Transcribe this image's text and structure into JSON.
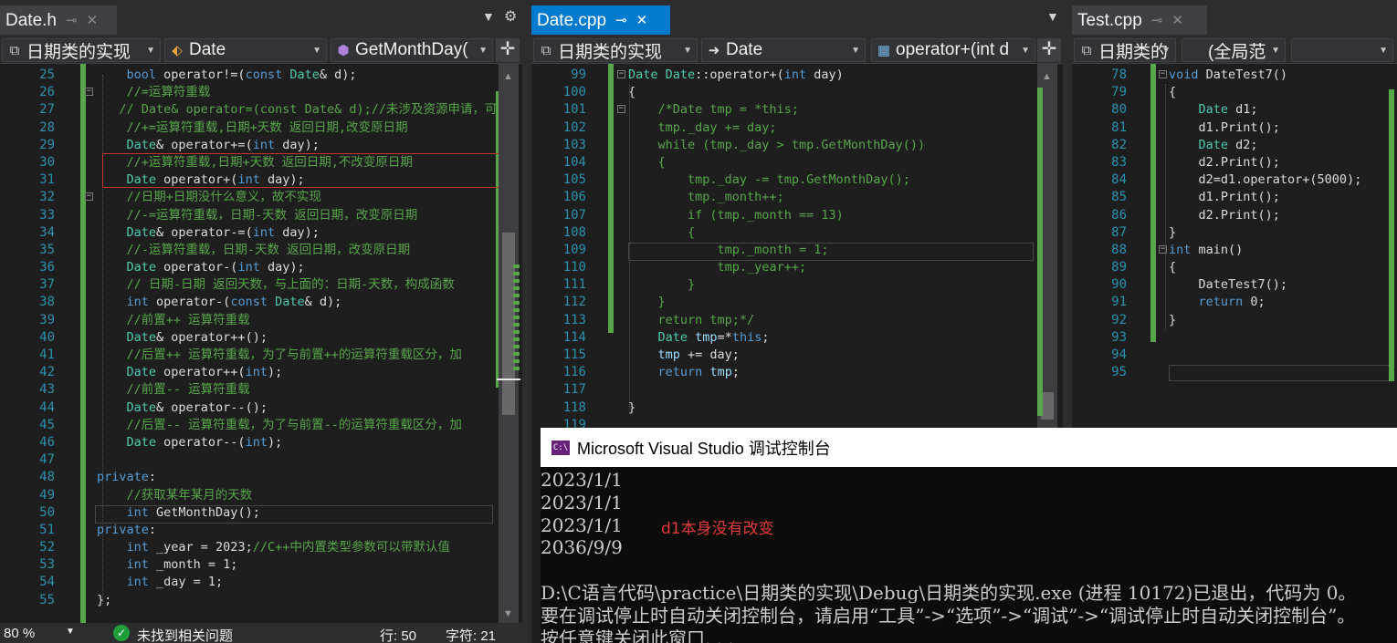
{
  "panes": {
    "date_h": {
      "tab": {
        "filename": "Date.h"
      },
      "nav": {
        "project": "日期类的实现",
        "class": "Date",
        "member": "GetMonthDay("
      },
      "lines": [
        {
          "n": "25",
          "seg": [
            {
              "t": "    "
            },
            {
              "t": "bool",
              "c": "#569cd6"
            },
            {
              "t": " operator!=("
            },
            {
              "t": "const",
              "c": "#569cd6"
            },
            {
              "t": " "
            },
            {
              "t": "Date",
              "c": "#4ec9b0"
            },
            {
              "t": "& d);"
            }
          ]
        },
        {
          "n": "26",
          "seg": [
            {
              "t": "    "
            },
            {
              "t": "//=运算符重载",
              "c": "#57a64a"
            }
          ]
        },
        {
          "n": "27",
          "seg": [
            {
              "t": "   "
            },
            {
              "t": "// Date& operator=(const Date& d);//未涉及资源申请，可",
              "c": "#57a64a"
            }
          ]
        },
        {
          "n": "28",
          "seg": [
            {
              "t": "    "
            },
            {
              "t": "//+=运算符重载,日期+天数 返回日期,改变原日期",
              "c": "#57a64a"
            }
          ]
        },
        {
          "n": "29",
          "seg": [
            {
              "t": "    "
            },
            {
              "t": "Date",
              "c": "#4ec9b0"
            },
            {
              "t": "& operator+=("
            },
            {
              "t": "int",
              "c": "#569cd6"
            },
            {
              "t": " day);"
            }
          ]
        },
        {
          "n": "30",
          "seg": [
            {
              "t": "    "
            },
            {
              "t": "//+运算符重载,日期+天数 返回日期,不改变原日期",
              "c": "#57a64a"
            }
          ]
        },
        {
          "n": "31",
          "seg": [
            {
              "t": "    "
            },
            {
              "t": "Date",
              "c": "#4ec9b0"
            },
            {
              "t": " operator+("
            },
            {
              "t": "int",
              "c": "#569cd6"
            },
            {
              "t": " day);"
            }
          ]
        },
        {
          "n": "32",
          "seg": [
            {
              "t": "    "
            },
            {
              "t": "//日期+日期没什么意义，故不实现",
              "c": "#57a64a"
            }
          ]
        },
        {
          "n": "33",
          "seg": [
            {
              "t": "    "
            },
            {
              "t": "//-=运算符重载，日期-天数 返回日期，改变原日期",
              "c": "#57a64a"
            }
          ]
        },
        {
          "n": "34",
          "seg": [
            {
              "t": "    "
            },
            {
              "t": "Date",
              "c": "#4ec9b0"
            },
            {
              "t": "& operator-=("
            },
            {
              "t": "int",
              "c": "#569cd6"
            },
            {
              "t": " day);"
            }
          ]
        },
        {
          "n": "35",
          "seg": [
            {
              "t": "    "
            },
            {
              "t": "//-运算符重载，日期-天数 返回日期，改变原日期",
              "c": "#57a64a"
            }
          ]
        },
        {
          "n": "36",
          "seg": [
            {
              "t": "    "
            },
            {
              "t": "Date",
              "c": "#4ec9b0"
            },
            {
              "t": " operator-("
            },
            {
              "t": "int",
              "c": "#569cd6"
            },
            {
              "t": " day);"
            }
          ]
        },
        {
          "n": "37",
          "seg": [
            {
              "t": "    "
            },
            {
              "t": "// 日期-日期 返回天数，与上面的：日期-天数，构成函数",
              "c": "#57a64a"
            }
          ]
        },
        {
          "n": "38",
          "seg": [
            {
              "t": "    "
            },
            {
              "t": "int",
              "c": "#569cd6"
            },
            {
              "t": " operator-("
            },
            {
              "t": "const",
              "c": "#569cd6"
            },
            {
              "t": " "
            },
            {
              "t": "Date",
              "c": "#4ec9b0"
            },
            {
              "t": "& d);"
            }
          ]
        },
        {
          "n": "39",
          "seg": [
            {
              "t": "    "
            },
            {
              "t": "//前置++ 运算符重载",
              "c": "#57a64a"
            }
          ]
        },
        {
          "n": "40",
          "seg": [
            {
              "t": "    "
            },
            {
              "t": "Date",
              "c": "#4ec9b0"
            },
            {
              "t": "& operator++();"
            }
          ]
        },
        {
          "n": "41",
          "seg": [
            {
              "t": "    "
            },
            {
              "t": "//后置++ 运算符重载，为了与前置++的运算符重载区分，加",
              "c": "#57a64a"
            }
          ]
        },
        {
          "n": "42",
          "seg": [
            {
              "t": "    "
            },
            {
              "t": "Date",
              "c": "#4ec9b0"
            },
            {
              "t": " operator++("
            },
            {
              "t": "int",
              "c": "#569cd6"
            },
            {
              "t": ");"
            }
          ]
        },
        {
          "n": "43",
          "seg": [
            {
              "t": "    "
            },
            {
              "t": "//前置-- 运算符重载",
              "c": "#57a64a"
            }
          ]
        },
        {
          "n": "44",
          "seg": [
            {
              "t": "    "
            },
            {
              "t": "Date",
              "c": "#4ec9b0"
            },
            {
              "t": "& operator--();"
            }
          ]
        },
        {
          "n": "45",
          "seg": [
            {
              "t": "    "
            },
            {
              "t": "//后置-- 运算符重载，为了与前置--的运算符重载区分，加",
              "c": "#57a64a"
            }
          ]
        },
        {
          "n": "46",
          "seg": [
            {
              "t": "    "
            },
            {
              "t": "Date",
              "c": "#4ec9b0"
            },
            {
              "t": " operator--("
            },
            {
              "t": "int",
              "c": "#569cd6"
            },
            {
              "t": ");"
            }
          ]
        },
        {
          "n": "47",
          "seg": [
            {
              "t": ""
            }
          ]
        },
        {
          "n": "48",
          "seg": [
            {
              "t": "private",
              "c": "#569cd6"
            },
            {
              "t": ":"
            }
          ]
        },
        {
          "n": "49",
          "seg": [
            {
              "t": "    "
            },
            {
              "t": "//获取某年某月的天数",
              "c": "#57a64a"
            }
          ]
        },
        {
          "n": "50",
          "seg": [
            {
              "t": "    "
            },
            {
              "t": "int",
              "c": "#569cd6"
            },
            {
              "t": " GetMonthDay();"
            }
          ]
        },
        {
          "n": "51",
          "seg": [
            {
              "t": "private",
              "c": "#569cd6"
            },
            {
              "t": ":"
            }
          ]
        },
        {
          "n": "52",
          "seg": [
            {
              "t": "    "
            },
            {
              "t": "int",
              "c": "#569cd6"
            },
            {
              "t": " _year = 2023;"
            },
            {
              "t": "//C++中内置类型参数可以带默认值",
              "c": "#57a64a"
            }
          ]
        },
        {
          "n": "53",
          "seg": [
            {
              "t": "    "
            },
            {
              "t": "int",
              "c": "#569cd6"
            },
            {
              "t": " _month = 1;"
            }
          ]
        },
        {
          "n": "54",
          "seg": [
            {
              "t": "    "
            },
            {
              "t": "int",
              "c": "#569cd6"
            },
            {
              "t": " _day = 1;"
            }
          ]
        },
        {
          "n": "55",
          "seg": [
            {
              "t": "};"
            }
          ]
        }
      ],
      "status": {
        "zoom": "80 %",
        "issues": "未找到相关问题",
        "line": "行: 50",
        "char": "字符: 21"
      }
    },
    "date_cpp": {
      "tab": {
        "filename": "Date.cpp"
      },
      "nav": {
        "project": "日期类的实现",
        "class": "Date",
        "member": "operator+(int d"
      },
      "lines": [
        {
          "n": "99",
          "seg": [
            {
              "t": "Date",
              "c": "#4ec9b0"
            },
            {
              "t": " "
            },
            {
              "t": "Date",
              "c": "#4ec9b0"
            },
            {
              "t": "::operator+("
            },
            {
              "t": "int",
              "c": "#569cd6"
            },
            {
              "t": " day)"
            }
          ]
        },
        {
          "n": "100",
          "seg": [
            {
              "t": "{"
            }
          ]
        },
        {
          "n": "101",
          "seg": [
            {
              "t": "    "
            },
            {
              "t": "/*Date tmp = *this;",
              "c": "#57a64a"
            }
          ]
        },
        {
          "n": "102",
          "seg": [
            {
              "t": "    "
            },
            {
              "t": "tmp._day += day;",
              "c": "#57a64a"
            }
          ]
        },
        {
          "n": "103",
          "seg": [
            {
              "t": "    "
            },
            {
              "t": "while (tmp._day > tmp.GetMonthDay())",
              "c": "#57a64a"
            }
          ]
        },
        {
          "n": "104",
          "seg": [
            {
              "t": "    "
            },
            {
              "t": "{",
              "c": "#57a64a"
            }
          ]
        },
        {
          "n": "105",
          "seg": [
            {
              "t": "        "
            },
            {
              "t": "tmp._day -= tmp.GetMonthDay();",
              "c": "#57a64a"
            }
          ]
        },
        {
          "n": "106",
          "seg": [
            {
              "t": "        "
            },
            {
              "t": "tmp._month++;",
              "c": "#57a64a"
            }
          ]
        },
        {
          "n": "107",
          "seg": [
            {
              "t": "        "
            },
            {
              "t": "if (tmp._month == 13)",
              "c": "#57a64a"
            }
          ]
        },
        {
          "n": "108",
          "seg": [
            {
              "t": "        "
            },
            {
              "t": "{",
              "c": "#57a64a"
            }
          ]
        },
        {
          "n": "109",
          "seg": [
            {
              "t": "            "
            },
            {
              "t": "tmp._month = 1;",
              "c": "#57a64a"
            }
          ]
        },
        {
          "n": "110",
          "seg": [
            {
              "t": "            "
            },
            {
              "t": "tmp._year++;",
              "c": "#57a64a"
            }
          ]
        },
        {
          "n": "111",
          "seg": [
            {
              "t": "        "
            },
            {
              "t": "}",
              "c": "#57a64a"
            }
          ]
        },
        {
          "n": "112",
          "seg": [
            {
              "t": "    "
            },
            {
              "t": "}",
              "c": "#57a64a"
            }
          ]
        },
        {
          "n": "113",
          "seg": [
            {
              "t": "    "
            },
            {
              "t": "return tmp;*/",
              "c": "#57a64a"
            }
          ]
        },
        {
          "n": "114",
          "seg": [
            {
              "t": "    "
            },
            {
              "t": "Date",
              "c": "#4ec9b0"
            },
            {
              "t": " "
            },
            {
              "t": "tmp",
              "c": "#9cdcfe"
            },
            {
              "t": "=*"
            },
            {
              "t": "this",
              "c": "#569cd6"
            },
            {
              "t": ";"
            }
          ]
        },
        {
          "n": "115",
          "seg": [
            {
              "t": "    "
            },
            {
              "t": "tmp",
              "c": "#9cdcfe"
            },
            {
              "t": " += day;"
            }
          ]
        },
        {
          "n": "116",
          "seg": [
            {
              "t": "    "
            },
            {
              "t": "return",
              "c": "#569cd6"
            },
            {
              "t": " "
            },
            {
              "t": "tmp",
              "c": "#9cdcfe"
            },
            {
              "t": ";"
            }
          ]
        },
        {
          "n": "117",
          "seg": [
            {
              "t": ""
            }
          ]
        },
        {
          "n": "118",
          "seg": [
            {
              "t": "}"
            }
          ]
        },
        {
          "n": "119",
          "seg": [
            {
              "t": ""
            }
          ]
        }
      ]
    },
    "test_cpp": {
      "tab": {
        "filename": "Test.cpp"
      },
      "nav": {
        "project": "日期类的",
        "scope": "(全局范",
        "member": ""
      },
      "lines": [
        {
          "n": "78",
          "seg": [
            {
              "t": "void",
              "c": "#569cd6"
            },
            {
              "t": " DateTest7()"
            }
          ]
        },
        {
          "n": "79",
          "seg": [
            {
              "t": "{"
            }
          ]
        },
        {
          "n": "80",
          "seg": [
            {
              "t": "    "
            },
            {
              "t": "Date",
              "c": "#4ec9b0"
            },
            {
              "t": " d1;"
            }
          ]
        },
        {
          "n": "81",
          "seg": [
            {
              "t": "    d1.Print();"
            }
          ]
        },
        {
          "n": "82",
          "seg": [
            {
              "t": "    "
            },
            {
              "t": "Date",
              "c": "#4ec9b0"
            },
            {
              "t": " d2;"
            }
          ]
        },
        {
          "n": "83",
          "seg": [
            {
              "t": "    d2.Print();"
            }
          ]
        },
        {
          "n": "84",
          "seg": [
            {
              "t": "    d2=d1.operator+(5000);"
            }
          ]
        },
        {
          "n": "85",
          "seg": [
            {
              "t": "    d1.Print();"
            }
          ]
        },
        {
          "n": "86",
          "seg": [
            {
              "t": "    d2.Print();"
            }
          ]
        },
        {
          "n": "87",
          "seg": [
            {
              "t": "}"
            }
          ]
        },
        {
          "n": "88",
          "seg": [
            {
              "t": "int",
              "c": "#569cd6"
            },
            {
              "t": " main()"
            }
          ]
        },
        {
          "n": "89",
          "seg": [
            {
              "t": "{"
            }
          ]
        },
        {
          "n": "90",
          "seg": [
            {
              "t": "    DateTest7();"
            }
          ]
        },
        {
          "n": "91",
          "seg": [
            {
              "t": "    "
            },
            {
              "t": "return",
              "c": "#569cd6"
            },
            {
              "t": " 0;"
            }
          ]
        },
        {
          "n": "92",
          "seg": [
            {
              "t": "}"
            }
          ]
        },
        {
          "n": "93",
          "seg": [
            {
              "t": ""
            }
          ]
        },
        {
          "n": "94",
          "seg": [
            {
              "t": ""
            }
          ]
        },
        {
          "n": "95",
          "seg": [
            {
              "t": ""
            }
          ]
        }
      ]
    }
  },
  "console": {
    "title": "Microsoft Visual Studio 调试控制台",
    "icon_label": "C:\\",
    "lines": [
      "2023/1/1",
      "2023/1/1",
      "2023/1/1",
      "2036/9/9",
      "",
      "D:\\C语言代码\\practice\\日期类的实现\\Debug\\日期类的实现.exe (进程 10172)已退出，代码为 0。",
      "要在调试停止时自动关闭控制台，请启用“工具”->“选项”->“调试”->“调试停止时自动关闭控制台”。",
      "按任意键关闭此窗口. . ."
    ],
    "annotation": "d1本身没有改变",
    "annotation_color": "#e03a3a"
  },
  "icons": {
    "pin": "pin-icon",
    "close": "close-icon",
    "dropdown": "dropdown-icon",
    "gear": "gear-icon",
    "split": "split-editor-icon",
    "check": "no-issues-check-icon"
  },
  "colors": {
    "accent": "#007acc",
    "comment": "#57a64a",
    "keyword": "#569cd6",
    "type": "#4ec9b0",
    "linenumber": "#2b91af",
    "highlight_box": "#c8322f"
  }
}
